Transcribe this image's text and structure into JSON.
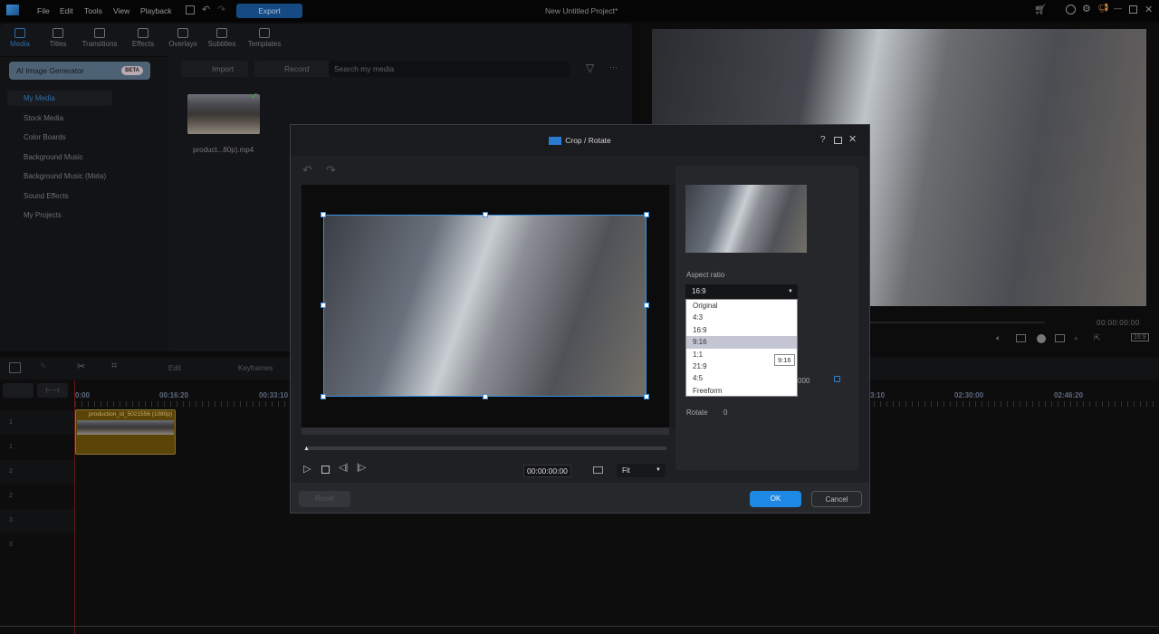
{
  "menu": [
    "File",
    "Edit",
    "Tools",
    "View",
    "Playback"
  ],
  "export_label": "Export",
  "project_title": "New Untitled Project*",
  "tabs": [
    "Media",
    "Titles",
    "Transitions",
    "Effects",
    "Overlays",
    "Subtitles",
    "Templates"
  ],
  "ai_generator": {
    "label": "AI Image Generator",
    "badge": "BETA"
  },
  "sidebar": [
    "My Media",
    "Stock Media",
    "Color Boards",
    "Background Music",
    "Background Music (Meta)",
    "Sound Effects",
    "My Projects"
  ],
  "media_toolbar": {
    "import": "Import",
    "record": "Record",
    "search_placeholder": "Search my media"
  },
  "media_item": "product...80p).mp4",
  "preview": {
    "timecode": "00:00:00:00",
    "aspect": "16:9"
  },
  "timeline": {
    "tools": [
      "Edit",
      "Keyframes"
    ],
    "ruler": [
      "0:00",
      "00:16:20",
      "00:33:10",
      "3:10",
      "02:30:00",
      "02:46:20"
    ],
    "clip": "production_id_5021556 (1080p)",
    "tracks": [
      "1",
      "1",
      "2",
      "2",
      "3",
      "3"
    ]
  },
  "dialog": {
    "title": "Crop / Rotate",
    "aspect_label": "Aspect ratio",
    "aspect_value": "16:9",
    "aspect_options": [
      "Original",
      "4:3",
      "16:9",
      "9:16",
      "1:1",
      "21:9",
      "4:5",
      "Freeform"
    ],
    "highlighted": "9:16",
    "tooltip": "9:16",
    "partial_value": "000",
    "rotate_label": "Rotate",
    "rotate_value": "0",
    "timecode": "00:00:00:00",
    "zoom": "Fit",
    "reset": "Reset",
    "ok": "OK",
    "cancel": "Cancel"
  },
  "colors": {
    "accent": "#1e88e5",
    "clip": "#5a4408"
  }
}
